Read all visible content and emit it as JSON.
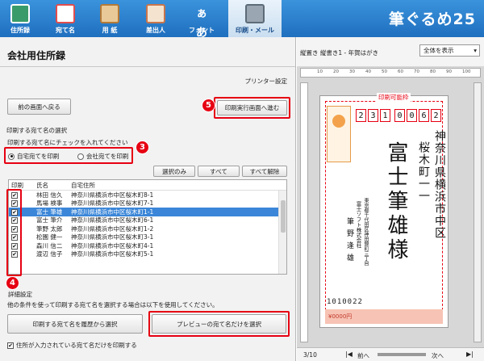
{
  "app": {
    "brand": "筆ぐるめ25"
  },
  "toolbar": {
    "items": [
      {
        "label": "住所録",
        "icon": "address-book-icon",
        "color": "#3a9b6a"
      },
      {
        "label": "宛て名",
        "icon": "postcard-icon",
        "color": "#e24d4d"
      },
      {
        "label": "用 紙",
        "icon": "paper-icon",
        "color": "#b57a38"
      },
      {
        "label": "差出人",
        "icon": "sender-card-icon",
        "color": "#c8754b"
      },
      {
        "label": "フォント",
        "icon": "font-icon",
        "glyph": "ぁあ"
      },
      {
        "label": "印刷・メール",
        "icon": "printer-icon",
        "active": true
      }
    ]
  },
  "left": {
    "title": "会社用住所録",
    "printer_settings": "プリンター設定",
    "back_button": "前の画面へ戻る",
    "proceed_button": "印刷実行画面へ進む",
    "section_label": "印刷する宛て名の選択",
    "check_hint": "印刷する宛て名にチェックを入れてください",
    "radio_self": "自宅宛てを印刷",
    "radio_company": "会社宛てを印刷",
    "select_only": "選択のみ",
    "select_all": "すべて",
    "clear_all": "すべて解除",
    "col_print": "印刷",
    "col_name": "氏名",
    "col_address": "自宅住所",
    "rows": [
      {
        "name": "林田 信久",
        "address": "神奈川県横浜市中区桜木町8-1",
        "checked": "✔"
      },
      {
        "name": "馬場 検事",
        "address": "神奈川県横浜市中区桜木町7-1",
        "checked": "✔"
      },
      {
        "name": "富士 筆雄",
        "address": "神奈川県横浜市中区桜木町1-1",
        "checked": "✔",
        "selected": true
      },
      {
        "name": "富士 筆介",
        "address": "神奈川県横浜市中区桜木町6-1",
        "checked": "✔"
      },
      {
        "name": "筆野 太郎",
        "address": "神奈川県横浜市中区桜木町1-2",
        "checked": "✔"
      },
      {
        "name": "松園 健一",
        "address": "神奈川県横浜市中区桜木町3-1",
        "checked": "✔"
      },
      {
        "name": "森川 信二",
        "address": "神奈川県横浜市中区桜木町4-1",
        "checked": "✔"
      },
      {
        "name": "渡辺 信子",
        "address": "神奈川県横浜市中区桜木町5-1",
        "checked": "✔"
      }
    ],
    "detail_label": "詳細設定",
    "detail_hint": "他の条件を使って印刷する宛て名を選択する場合は以下を使用してください。",
    "history_button": "印刷する宛て名を履歴から選択",
    "preview_button": "プレビューの宛て名だけを選択",
    "only_address_label": "住所が入力されている宛て名だけを印刷する",
    "only_address_check": "✔"
  },
  "badges": {
    "b3": "3",
    "b4": "4",
    "b5": "5"
  },
  "preview": {
    "paper_label": "縦置き 縦書き1 - 年賀はがき",
    "zoom": "全体を表示",
    "printable_area": "印刷可能枠",
    "zip": [
      "2",
      "3",
      "1",
      "0",
      "0",
      "6",
      "2"
    ],
    "addr_line1": "神奈川県横浜市中区",
    "addr_line2": "桜木町一一",
    "recipient": "富士筆雄様",
    "sender_addr1": "東京都千代田区神田錦町三丁目",
    "sender_addr2": "富士ソフト株式会社",
    "sender_name": "筆野逢雄",
    "sender_zip": "1010022",
    "stamp_text": "¥0000円",
    "page": "3/10",
    "prev": "前へ",
    "next": "次へ",
    "ruler_marks": [
      "10",
      "20",
      "30",
      "40",
      "50",
      "60",
      "70",
      "80",
      "90",
      "100"
    ]
  }
}
